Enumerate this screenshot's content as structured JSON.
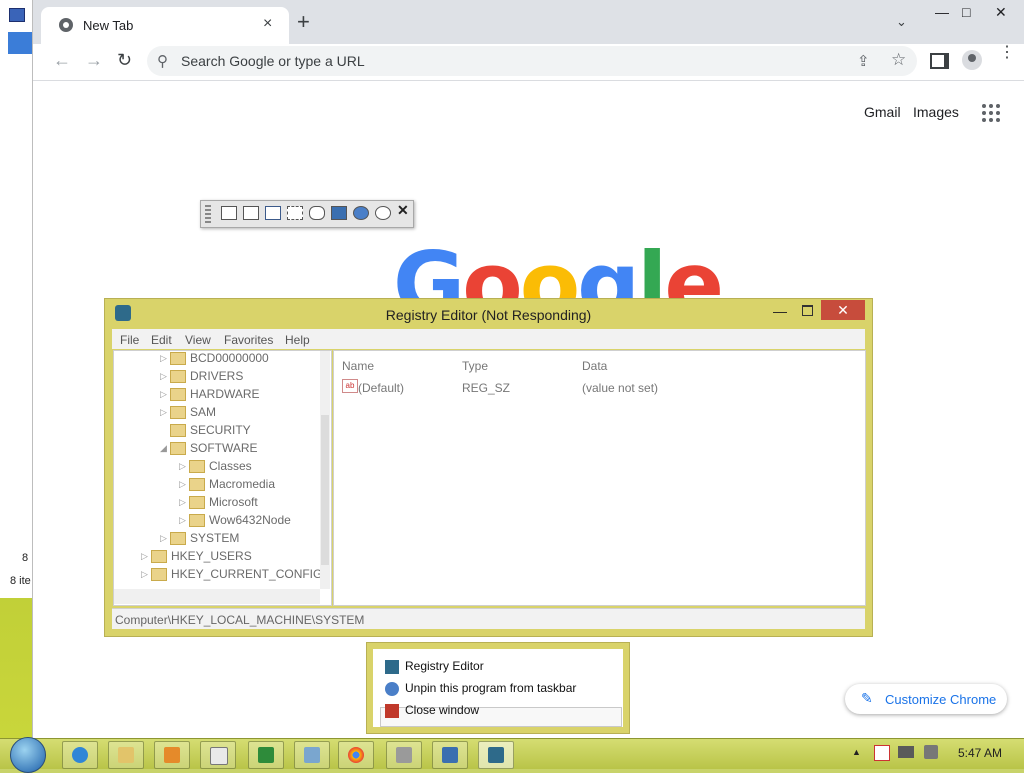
{
  "desktop_window": {
    "status_count": "8",
    "status_items": "8 ite"
  },
  "browser": {
    "tab_title": "New Tab",
    "tab_close": "×",
    "new_tab": "+",
    "tab_search": "⌄",
    "window_min": "—",
    "window_max": "□",
    "window_close": "✕",
    "back": "←",
    "forward": "→",
    "reload": "↻",
    "omnibox_placeholder": "Search Google or type a URL",
    "share_icon": "⇪",
    "star_icon": "☆",
    "menu_icon": "⋮",
    "links": {
      "gmail": "Gmail",
      "images": "Images"
    },
    "logo": [
      "G",
      "o",
      "o",
      "g",
      "l",
      "e"
    ],
    "logo_colors": [
      "#4285f4",
      "#ea4335",
      "#fbbc05",
      "#4285f4",
      "#34a853",
      "#ea4335"
    ],
    "customize_icon": "✎",
    "customize_label": "Customize Chrome"
  },
  "floating_toolbar": {
    "close": "✕"
  },
  "registry": {
    "title": "Registry Editor (Not Responding)",
    "min": "—",
    "close": "✕",
    "menu": [
      "File",
      "Edit",
      "View",
      "Favorites",
      "Help"
    ],
    "tree": [
      {
        "label": "BCD00000000"
      },
      {
        "label": "DRIVERS"
      },
      {
        "label": "HARDWARE"
      },
      {
        "label": "SAM"
      },
      {
        "label": "SECURITY"
      },
      {
        "label": "SOFTWARE"
      },
      {
        "label": "Classes"
      },
      {
        "label": "Macromedia"
      },
      {
        "label": "Microsoft"
      },
      {
        "label": "Wow6432Node"
      },
      {
        "label": "SYSTEM"
      },
      {
        "label": "HKEY_USERS"
      },
      {
        "label": "HKEY_CURRENT_CONFIG"
      }
    ],
    "columns": {
      "name": "Name",
      "type": "Type",
      "data": "Data"
    },
    "rows": [
      {
        "name": "(Default)",
        "type": "REG_SZ",
        "data": "(value not set)"
      }
    ],
    "status": "Computer\\HKEY_LOCAL_MACHINE\\SYSTEM"
  },
  "jumplist": {
    "items": [
      "Registry Editor",
      "Unpin this program from taskbar",
      "Close window"
    ]
  },
  "taskbar": {
    "time": "5:47 AM",
    "tray_arrow": "▲"
  }
}
